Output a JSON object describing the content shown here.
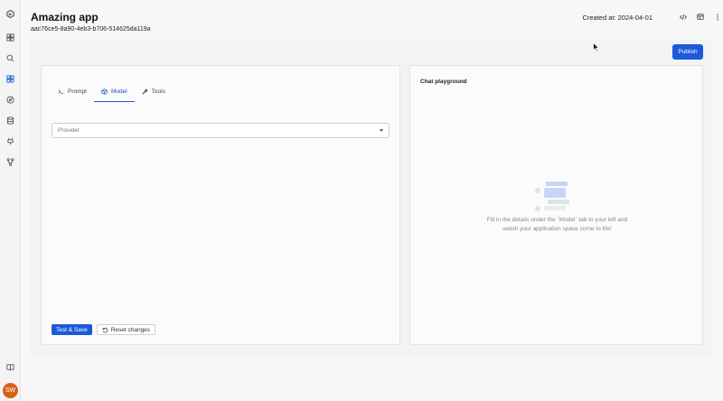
{
  "sidebar": {
    "items": [
      {
        "icon": "logo-icon"
      },
      {
        "icon": "dashboard-icon"
      },
      {
        "icon": "search-icon"
      },
      {
        "icon": "apps-icon"
      },
      {
        "icon": "compass-icon"
      },
      {
        "icon": "database-icon"
      },
      {
        "icon": "plugin-icon"
      },
      {
        "icon": "branch-icon"
      },
      {
        "icon": "book-icon"
      }
    ],
    "avatar_initials": "SW"
  },
  "header": {
    "title": "Amazing app",
    "app_id": "aac76ce5-8a90-4eb3-b706-514625da119a",
    "created_at": "Created at: 2024-04-01"
  },
  "toolbar": {
    "publish_label": "Publish"
  },
  "tabs": [
    {
      "label": "Prompt",
      "icon": "terminal-icon"
    },
    {
      "label": "Model",
      "icon": "cube-icon"
    },
    {
      "label": "Tools",
      "icon": "wrench-icon"
    }
  ],
  "active_tab": "Model",
  "provider_select": {
    "placeholder": "Provider"
  },
  "actions": {
    "test_save_label": "Test & Save",
    "reset_label": "Reset changes"
  },
  "chat": {
    "title": "Chat playground",
    "empty_message": "Fill in the details under the `Model` tab to your left and watch your application space come to life!"
  },
  "colors": {
    "accent": "#1d5ad9",
    "avatar": "#d95f16"
  }
}
